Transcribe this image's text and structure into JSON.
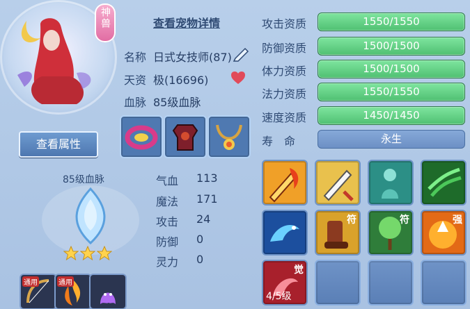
{
  "badge": {
    "text": "神兽"
  },
  "header": {
    "detail_link": "查看宠物详情"
  },
  "pet": {
    "name_label": "名称",
    "name_value": "日式女技师(87)",
    "aptitude_label": "天资",
    "aptitude_value": "极(16696)",
    "bloodline_label": "血脉",
    "bloodline_value": "85级血脉"
  },
  "buttons": {
    "view_attributes": "查看属性"
  },
  "bloodline_panel": {
    "title": "85级血脉",
    "stars": 3
  },
  "attributes": [
    {
      "label": "气血",
      "value": "113"
    },
    {
      "label": "魔法",
      "value": "171"
    },
    {
      "label": "攻击",
      "value": "24"
    },
    {
      "label": "防御",
      "value": "0"
    },
    {
      "label": "灵力",
      "value": "0"
    }
  ],
  "aptitudes": [
    {
      "label": "攻击资质",
      "value": "1550/1550"
    },
    {
      "label": "防御资质",
      "value": "1500/1500"
    },
    {
      "label": "体力资质",
      "value": "1500/1500"
    },
    {
      "label": "法力资质",
      "value": "1550/1550"
    },
    {
      "label": "速度资质",
      "value": "1450/1450"
    }
  ],
  "lifespan": {
    "label": "寿　命",
    "value": "永生"
  },
  "skills": {
    "awakened": {
      "tag": "觉",
      "level": "4/5级"
    },
    "tags": {
      "fu": "符",
      "qiang": "强",
      "tongyong": "通用"
    }
  },
  "icons": {
    "equipment": [
      "bracelet-icon",
      "armor-icon",
      "necklace-icon"
    ],
    "skills": [
      "sword-fire-icon",
      "sword-strike-icon",
      "spirit-icon",
      "claw-icon",
      "dragon-icon",
      "boot-talisman-icon",
      "tree-talisman-icon",
      "strength-icon",
      "awaken-icon"
    ],
    "bottom": [
      "bow-icon",
      "flame-icon",
      "ghost-icon"
    ]
  },
  "colors": {
    "accent": "#4fc072",
    "panel": "#b8cfea"
  }
}
